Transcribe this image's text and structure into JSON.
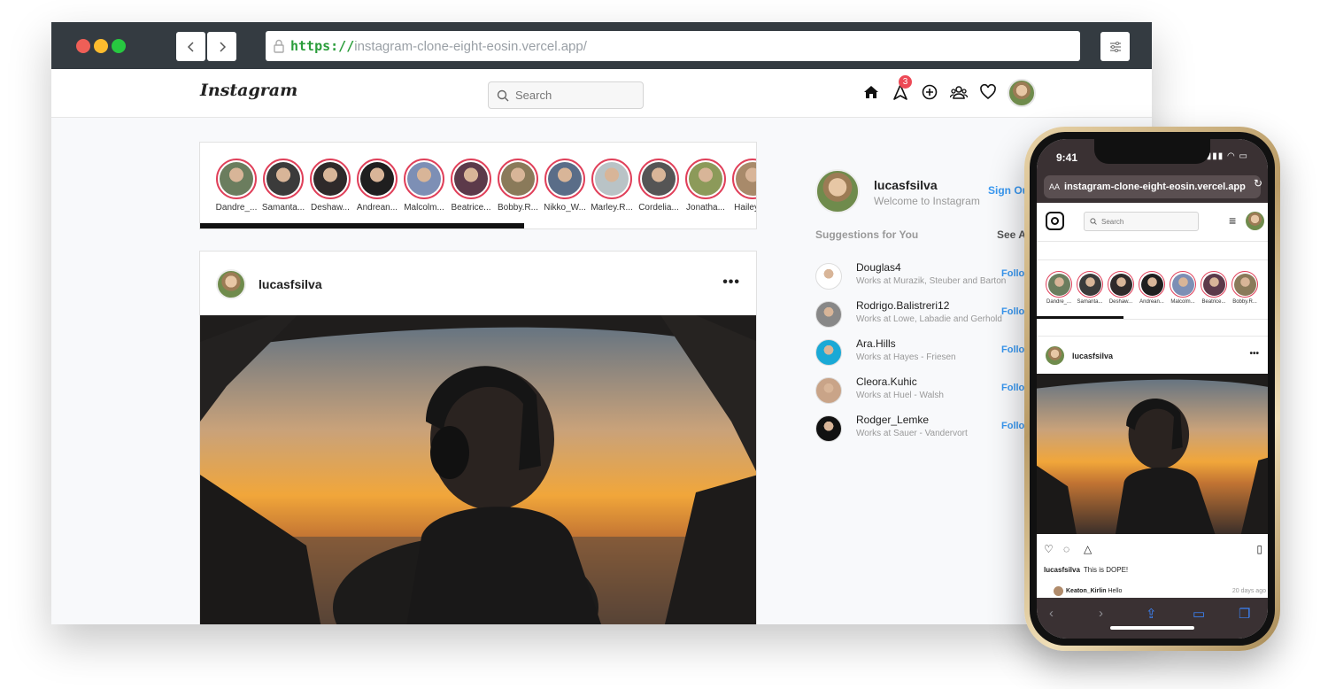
{
  "browser": {
    "url_protocol": "https://",
    "url_host": "instagram-clone-eight-eosin.vercel.app/"
  },
  "app": {
    "logo": "Instagram",
    "search_placeholder": "Search",
    "notification_count": "3",
    "current_user": "lucasfsilva",
    "welcome": "Welcome to Instagram",
    "sign_out": "Sign Out",
    "suggestions_title": "Suggestions for You",
    "see_all": "See All",
    "follow_label": "Follow"
  },
  "stories": [
    {
      "name": "Dandre_...",
      "color": "#6b7d5e"
    },
    {
      "name": "Samanta...",
      "color": "#3b3b3b"
    },
    {
      "name": "Deshaw...",
      "color": "#2f2a2a"
    },
    {
      "name": "Andrean...",
      "color": "#1f1f1f"
    },
    {
      "name": "Malcolm...",
      "color": "#7d8fb5"
    },
    {
      "name": "Beatrice...",
      "color": "#5c3a4a"
    },
    {
      "name": "Bobby.R...",
      "color": "#8a7a5a"
    },
    {
      "name": "Nikko_W...",
      "color": "#5a6d88"
    },
    {
      "name": "Marley.R...",
      "color": "#b9c3c6"
    },
    {
      "name": "Cordelia...",
      "color": "#555555"
    },
    {
      "name": "Jonatha...",
      "color": "#8c9a5a"
    },
    {
      "name": "Hailey_...",
      "color": "#a88a6a"
    }
  ],
  "post": {
    "username": "lucasfsilva",
    "menu": "•••",
    "caption": "This is DOPE!",
    "comment_user": "Keaton_Kirlin",
    "comment_text": "Hello",
    "comment_time": "20 days ago"
  },
  "suggestions": [
    {
      "name": "Douglas4",
      "works": "Works at Murazik, Steuber and Barton",
      "color": "#ffffff"
    },
    {
      "name": "Rodrigo.Balistreri12",
      "works": "Works at Lowe, Labadie and Gerhold",
      "color": "#888888"
    },
    {
      "name": "Ara.Hills",
      "works": "Works at Hayes - Friesen",
      "color": "#1aa9d6"
    },
    {
      "name": "Cleora.Kuhic",
      "works": "Works at Huel - Walsh",
      "color": "#c9a488"
    },
    {
      "name": "Rodger_Lemke",
      "works": "Works at Sauer - Vandervort",
      "color": "#111111"
    }
  ],
  "phone": {
    "time": "9:41",
    "aa": "AA",
    "url": "instagram-clone-eight-eosin.vercel.app",
    "search_placeholder": "Search",
    "stories": [
      {
        "name": "Dandre_...",
        "color": "#6b7d5e"
      },
      {
        "name": "Samanta...",
        "color": "#3b3b3b"
      },
      {
        "name": "Deshaw...",
        "color": "#2f2a2a"
      },
      {
        "name": "Andrean...",
        "color": "#1f1f1f"
      },
      {
        "name": "Malcolm...",
        "color": "#7d8fb5"
      },
      {
        "name": "Beatrice...",
        "color": "#5c3a4a"
      },
      {
        "name": "Bobby.R...",
        "color": "#8a7a5a"
      }
    ]
  },
  "colors": {
    "accent": "#3897f0",
    "story_ring": "#e0405a",
    "badge": "#ed4956",
    "chrome": "#343b41"
  }
}
